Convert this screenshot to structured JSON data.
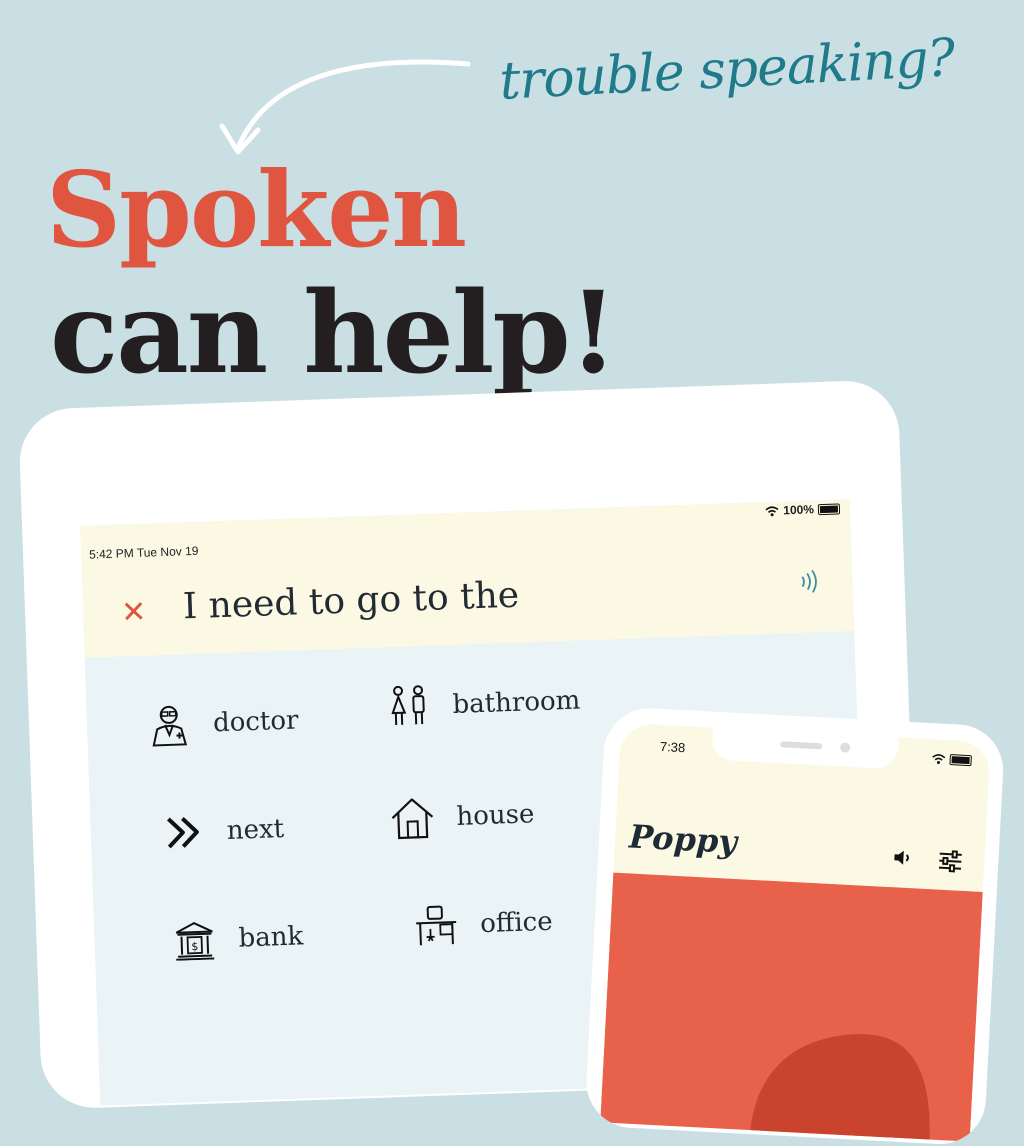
{
  "tagline": "trouble speaking?",
  "headline": {
    "line1": "Spoken",
    "line2": "can help!"
  },
  "tablet": {
    "status": {
      "time": "5:42 PM  Tue Nov 19",
      "battery": "100%"
    },
    "phrase": "I need to go to the",
    "close_icon": "close-icon",
    "speak_icon": "speaking-icon",
    "suggestions": [
      {
        "label": "doctor",
        "icon": "doctor-icon"
      },
      {
        "label": "bathroom",
        "icon": "bathroom-icon"
      },
      {
        "label": "next",
        "icon": "next-icon"
      },
      {
        "label": "house",
        "icon": "house-icon"
      },
      {
        "label": "bank",
        "icon": "bank-icon"
      },
      {
        "label": "office",
        "icon": "office-icon"
      }
    ]
  },
  "phone": {
    "status": {
      "time": "7:38"
    },
    "title": "Poppy",
    "card_color": "#e8614a"
  },
  "colors": {
    "background": "#c9dfe3",
    "accent_red": "#e0553f",
    "teal": "#1f7a8a",
    "dark": "#231f20"
  }
}
